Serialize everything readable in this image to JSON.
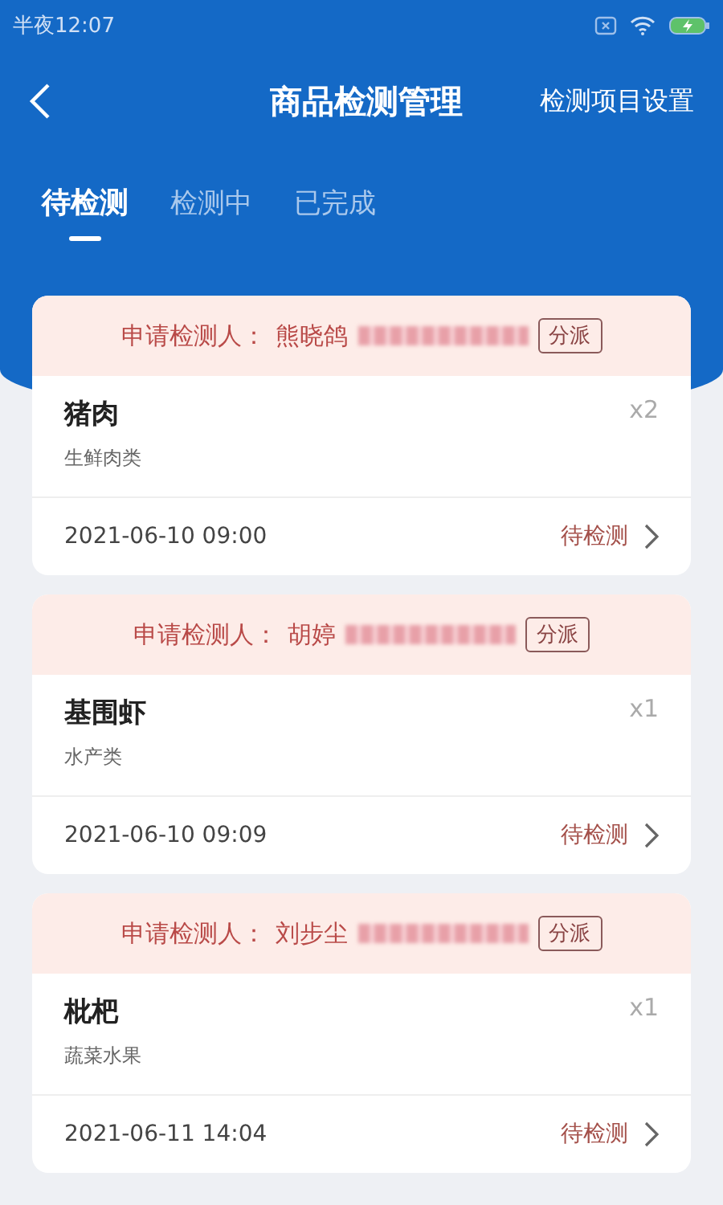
{
  "status_bar": {
    "time": "半夜12:07"
  },
  "header": {
    "title": "商品检测管理",
    "action": "检测项目设置"
  },
  "tabs": [
    {
      "label": "待检测",
      "selected": true
    },
    {
      "label": "检测中",
      "selected": false
    },
    {
      "label": "已完成",
      "selected": false
    }
  ],
  "orders": [
    {
      "applicant_label": "申请检测人：",
      "applicant": "熊晓鸽",
      "assign": "分派",
      "product": "猪肉",
      "category": "生鲜肉类",
      "quantity": "x2",
      "date": "2021-06-10 09:00",
      "status": "待检测"
    },
    {
      "applicant_label": "申请检测人：",
      "applicant": "胡婷",
      "assign": "分派",
      "product": "基围虾",
      "category": "水产类",
      "quantity": "x1",
      "date": "2021-06-10 09:09",
      "status": "待检测"
    },
    {
      "applicant_label": "申请检测人：",
      "applicant": "刘步尘",
      "assign": "分派",
      "product": "枇杷",
      "category": "蔬菜水果",
      "quantity": "x1",
      "date": "2021-06-11 14:04",
      "status": "待检测"
    }
  ]
}
